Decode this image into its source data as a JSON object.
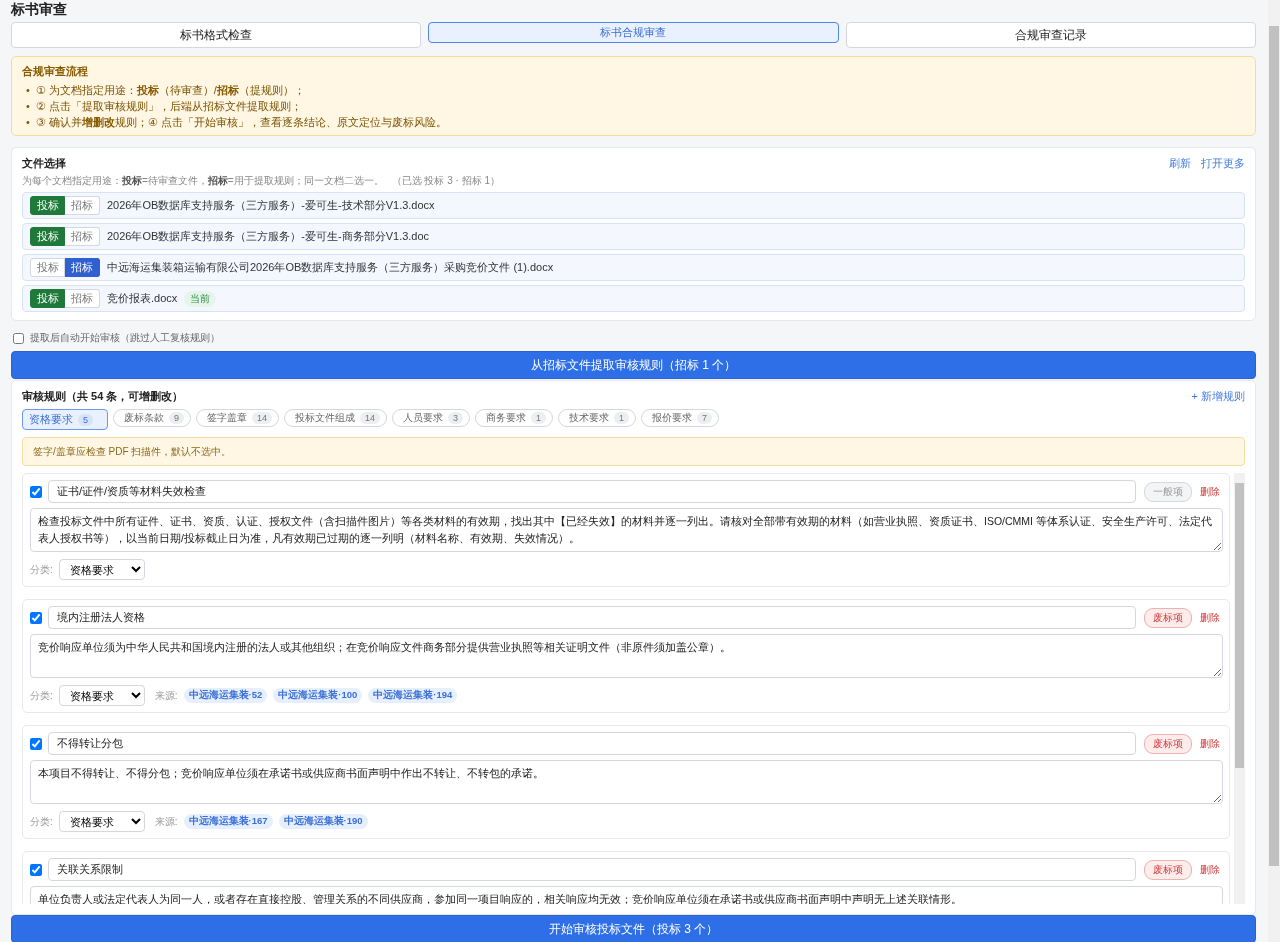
{
  "page_title": "标书审查",
  "tabs": [
    {
      "label": "标书格式检查",
      "selected": false
    },
    {
      "label": "标书合规审查",
      "selected": true
    },
    {
      "label": "合规审查记录",
      "selected": false
    }
  ],
  "process": {
    "title": "合规审查流程",
    "steps": [
      {
        "marker": "•",
        "text": "① 为文档指定用途：**投标**（待审查）/**招标**（提规则）；"
      },
      {
        "marker": "•",
        "text": "② 点击「提取审核规则」，后端从招标文件提取规则；"
      },
      {
        "marker": "•",
        "text": "③ 确认并**增删改**规则；④ 点击「开始审核」，查看逐条结论、原文定位与废标风险。"
      }
    ]
  },
  "files": {
    "title": "文件选择",
    "hint": "为每个文档指定用途：**投标**=待审查文件，**招标**=用于提取规则；同一文档二选一。",
    "summary": "（已选 投标 3 · 招标 1）",
    "actions": [
      "刷新",
      "打开更多"
    ],
    "items": [
      {
        "options": [
          {
            "label": "投标",
            "selected": true
          },
          {
            "label": "招标",
            "selected": false
          }
        ],
        "name": "2026年OB数据库支持服务（三方服务）-爱可生-技术部分V1.3.docx"
      },
      {
        "options": [
          {
            "label": "投标",
            "selected": true
          },
          {
            "label": "招标",
            "selected": false
          }
        ],
        "name": "2026年OB数据库支持服务（三方服务）-爱可生-商务部分V1.3.doc"
      },
      {
        "options": [
          {
            "label": "投标",
            "selected": false
          },
          {
            "label": "招标",
            "selected": true
          }
        ],
        "name": "中远海运集装箱运输有限公司2026年OB数据库支持服务（三方服务）采购竞价文件 (1).docx"
      },
      {
        "options": [
          {
            "label": "投标",
            "selected": true
          },
          {
            "label": "招标",
            "selected": false
          }
        ],
        "name": "竞价报表.docx",
        "badge": "当前"
      }
    ]
  },
  "auto_start": {
    "label": "提取后自动开始审核（跳过人工复核规则）",
    "checked": false
  },
  "extract_button": "从招标文件提取审核规则（招标 1 个）",
  "rules": {
    "title": "审核规则（共 54 条，可增删改）",
    "add": "+ 新增规则",
    "categories": [
      {
        "label": "资格要求",
        "count": "5",
        "selected": true
      },
      {
        "label": "废标条款",
        "count": "9",
        "selected": false
      },
      {
        "label": "签字盖章",
        "count": "14",
        "selected": false
      },
      {
        "label": "投标文件组成",
        "count": "14",
        "selected": false
      },
      {
        "label": "人员要求",
        "count": "3",
        "selected": false
      },
      {
        "label": "商务要求",
        "count": "1",
        "selected": false
      },
      {
        "label": "技术要求",
        "count": "1",
        "selected": false
      },
      {
        "label": "报价要求",
        "count": "7",
        "selected": false
      }
    ],
    "notice": "签字/盖章应检查 PDF 扫描件，默认不选中。",
    "items": [
      {
        "checked": true,
        "title": "证书/证件/资质等材料失效检查",
        "level": "一般项",
        "kind": "normal",
        "delete": "删除",
        "description": "检查投标文件中所有证件、证书、资质、认证、授权文件（含扫描件图片）等各类材料的有效期，找出其中【已经失效】的材料并逐一列出。请核对全部带有效期的材料（如营业执照、资质证书、ISO/CMMI 等体系认证、安全生产许可、法定代表人授权书等），以当前日期/投标截止日为准，凡有效期已过期的逐一列明（材料名称、有效期、失效情况）。",
        "category_label": "分类:",
        "category": "资格要求"
      },
      {
        "checked": true,
        "title": "境内注册法人资格",
        "level": "废标项",
        "kind": "disqualify",
        "delete": "删除",
        "description": "竞价响应单位须为中华人民共和国境内注册的法人或其他组织；在竞价响应文件商务部分提供营业执照等相关证明文件（非原件须加盖公章）。",
        "category_label": "分类:",
        "category": "资格要求",
        "source_label": "来源:",
        "sources": [
          "中远海运集装·52",
          "中远海运集装·100",
          "中远海运集装·194"
        ]
      },
      {
        "checked": true,
        "title": "不得转让分包",
        "level": "废标项",
        "kind": "disqualify",
        "delete": "删除",
        "description": "本项目不得转让、不得分包；竞价响应单位须在承诺书或供应商书面声明中作出不转让、不转包的承诺。",
        "category_label": "分类:",
        "category": "资格要求",
        "source_label": "来源:",
        "sources": [
          "中远海运集装·167",
          "中远海运集装·190"
        ]
      },
      {
        "checked": true,
        "title": "关联关系限制",
        "level": "废标项",
        "kind": "disqualify",
        "delete": "删除",
        "description": "单位负责人或法定代表人为同一人，或者存在直接控股、管理关系的不同供应商，参加同一项目响应的，相关响应均无效；竞价响应单位须在承诺书或供应商书面声明中声明无上述关联情形。"
      }
    ]
  },
  "start_button": "开始审核投标文件（投标 3 个）"
}
